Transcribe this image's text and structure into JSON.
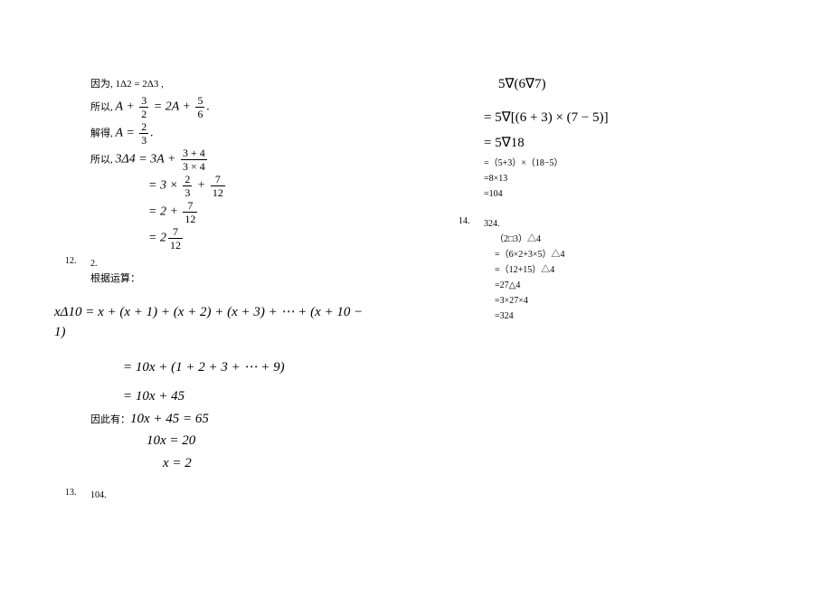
{
  "left": {
    "l1": "因为,  1Δ2 = 2Δ3 ,",
    "l2_pre": "所以,  ",
    "l2_a": "A",
    "l2_plus1": " + ",
    "l2_f1n": "3",
    "l2_f1d": "2",
    "l2_eq": " = 2",
    "l2_a2": "A",
    "l2_plus2": " + ",
    "l2_f2n": "5",
    "l2_f2d": "6",
    "l2_dot": ".",
    "l3_pre": "解得,  ",
    "l3_a": "A",
    "l3_eq": " = ",
    "l3_fn": "2",
    "l3_fd": "3",
    "l3_dot": ".",
    "l4_pre": "所以,  ",
    "l4_lhs": "3Δ4 = 3",
    "l4_a": "A",
    "l4_plus": " + ",
    "l4_fn": "3 + 4",
    "l4_fd": "3 × 4",
    "l5_eq": "= 3 × ",
    "l5_f1n": "2",
    "l5_f1d": "3",
    "l5_plus": " + ",
    "l5_f2n": "7",
    "l5_f2d": "12",
    "l6_eq": "= 2 + ",
    "l6_fn": "7",
    "l6_fd": "12",
    "l7_eq": "= 2",
    "l7_fn": "7",
    "l7_fd": "12",
    "p12_num": "12.",
    "p12_ans": "2.",
    "p12_text": "根据运算：",
    "eq1": "xΔ10 = x + (x + 1) + (x + 2) + (x + 3) + ⋯ + (x + 10 − 1)",
    "eq2": "= 10x + (1 + 2 + 3 + ⋯ + 9)",
    "eq3": "= 10x + 45",
    "eq4_pre": "因此有：",
    "eq4": "10x + 45 = 65",
    "eq5": "10x = 20",
    "eq6": "x = 2",
    "p13_num": "13.",
    "p13_ans": "104."
  },
  "right": {
    "r1": "5∇(6∇7)",
    "r2": "= 5∇[(6 + 3) × (7 − 5)]",
    "r3": "= 5∇18",
    "r4": "=（5+3）×（18−5）",
    "r5": "=8×13",
    "r6": "=104",
    "p14_num": "14.",
    "p14_ans": "324.",
    "s1": "（2□3）△4",
    "s2": "=（6×2+3×5）△4",
    "s3": "=（12+15）△4",
    "s4": "=27△4",
    "s5": "=3×27×4",
    "s6": "=324"
  }
}
